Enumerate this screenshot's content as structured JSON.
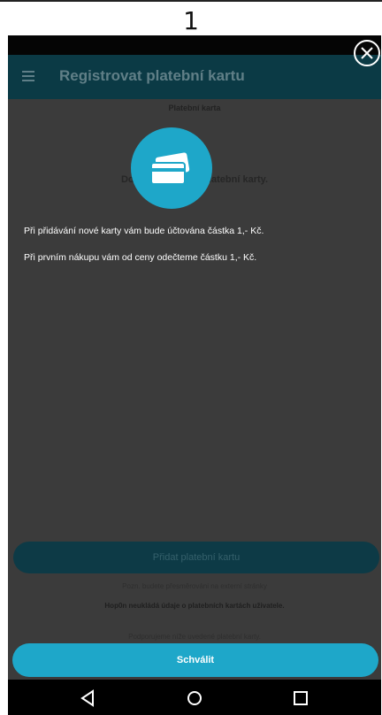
{
  "step": {
    "number": "1"
  },
  "app_bar": {
    "title": "Registrovat platební kartu",
    "menu_icon": "hamburger-menu-icon"
  },
  "background": {
    "section_label": "Platební karta",
    "no_cards_text": "Dosud n…                          žádné platební karty.",
    "add_card_label": "Přidat platební kartu",
    "note_redirect": "Pozn. budete přesměrováni na externí stránky",
    "note_storage": "Hop0n neukládá údaje o platebních kartách uživatele.",
    "note_supported": "Podporujeme níže uvedené platební karty."
  },
  "dialog": {
    "icon": "payment-card-icon",
    "line1": "Při přidávání nové karty vám bude účtována částka 1,- Kč.",
    "line2": "Při prvním nákupu vám od ceny odečteme částku 1,- Kč.",
    "approve_label": "Schválit",
    "close_icon": "close-icon"
  },
  "nav": {
    "back": "back-icon",
    "home": "home-icon",
    "recents": "recents-icon"
  },
  "colors": {
    "accent": "#1ea7c9",
    "overlay": "#3b3b3b",
    "appbar": "#0b3a45"
  }
}
